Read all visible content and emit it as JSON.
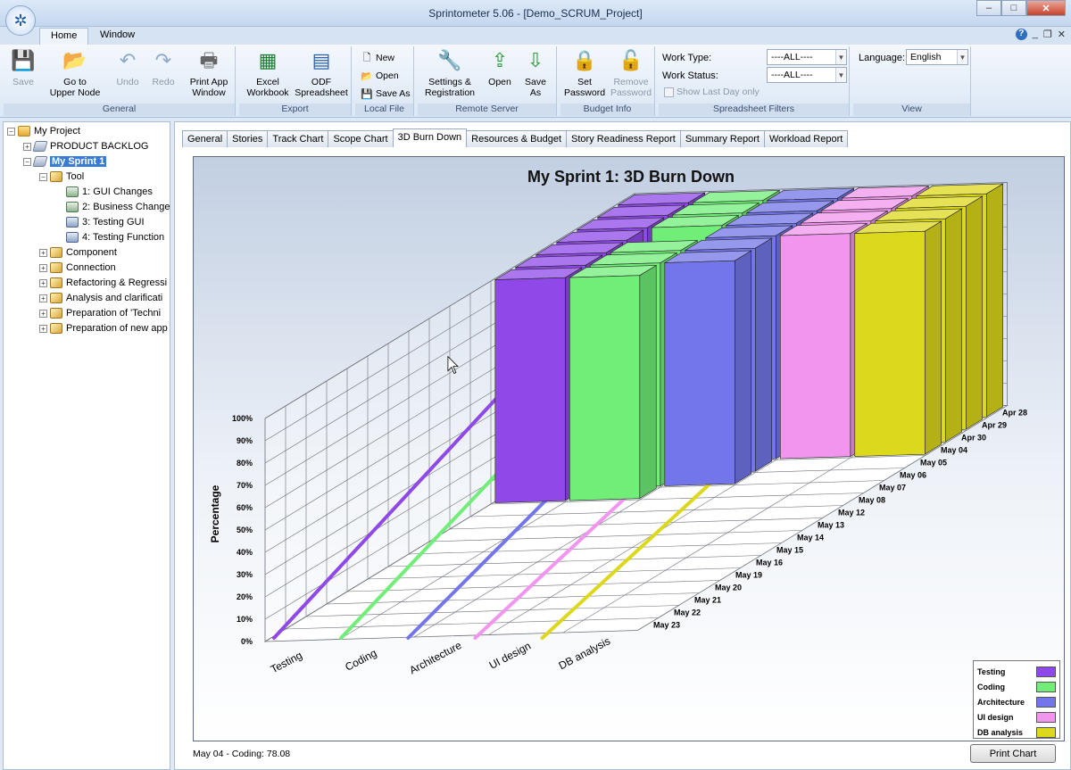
{
  "window": {
    "title": "Sprintometer 5.06 - [Demo_SCRUM_Project]",
    "min": "–",
    "max": "□",
    "close": "✕"
  },
  "ribbon_tabs": [
    "Home",
    "Window"
  ],
  "mdi": {
    "help": "?",
    "min": "_",
    "restore": "❐",
    "close": "✕"
  },
  "groups": {
    "general": "General",
    "export": "Export",
    "local_file": "Local File",
    "remote_server": "Remote Server",
    "budget_info": "Budget Info",
    "filters": "Spreadsheet Filters",
    "view": "View"
  },
  "buttons": {
    "save": "Save",
    "go_upper_1": "Go to",
    "go_upper_2": "Upper Node",
    "undo": "Undo",
    "redo": "Redo",
    "print_1": "Print App",
    "print_2": "Window",
    "excel_1": "Excel",
    "excel_2": "Workbook",
    "odf_1": "ODF",
    "odf_2": "Spreadsheet",
    "new": "New",
    "open_file": "Open",
    "save_as_file": "Save As",
    "settings_1": "Settings &",
    "settings_2": "Registration",
    "open": "Open",
    "save_as_1": "Save",
    "save_as_2": "As",
    "set_pw_1": "Set",
    "set_pw_2": "Password",
    "rem_pw_1": "Remove",
    "rem_pw_2": "Password"
  },
  "filters": {
    "work_type_label": "Work Type:",
    "work_type_value": "----ALL----",
    "work_status_label": "Work Status:",
    "work_status_value": "----ALL----",
    "last_day": "Show Last Day only"
  },
  "view": {
    "language_label": "Language:",
    "language_value": "English"
  },
  "tree": [
    {
      "label": "My Project",
      "level": 0,
      "exp": "−",
      "icon": "project-icon"
    },
    {
      "label": "PRODUCT BACKLOG",
      "level": 1,
      "exp": "+",
      "icon": "book-icon"
    },
    {
      "label": "My Sprint 1",
      "level": 1,
      "exp": "−",
      "icon": "book-icon",
      "selected": true
    },
    {
      "label": "Tool",
      "level": 2,
      "exp": "−",
      "icon": "pencil-icon"
    },
    {
      "label": "1: GUI Changes",
      "level": 3,
      "icon": "task-icon"
    },
    {
      "label": "2: Business Change",
      "level": 3,
      "icon": "task-icon"
    },
    {
      "label": "3: Testing GUI",
      "level": 3,
      "icon": "task-blue-icon"
    },
    {
      "label": "4: Testing Function",
      "level": 3,
      "icon": "task-blue-icon"
    },
    {
      "label": "Component",
      "level": 2,
      "exp": "+",
      "icon": "pencil-icon"
    },
    {
      "label": "Connection",
      "level": 2,
      "exp": "+",
      "icon": "pencil-icon"
    },
    {
      "label": "Refactoring & Regressi",
      "level": 2,
      "exp": "+",
      "icon": "pencil-icon"
    },
    {
      "label": "Analysis and clarificati",
      "level": 2,
      "exp": "+",
      "icon": "pencil-icon"
    },
    {
      "label": "Preparation of 'Techni",
      "level": 2,
      "exp": "+",
      "icon": "pencil-icon"
    },
    {
      "label": "Preparation of new app",
      "level": 2,
      "exp": "+",
      "icon": "pencil-icon"
    }
  ],
  "tabs": [
    "General",
    "Stories",
    "Track Chart",
    "Scope Chart",
    "3D Burn Down",
    "Resources & Budget",
    "Story Readiness Report",
    "Summary Report",
    "Workload Report"
  ],
  "active_tab": "3D Burn Down",
  "chart_data": {
    "type": "bar",
    "title": "My Sprint 1: 3D Burn Down",
    "ylabel": "Percentage",
    "ylim": [
      0,
      100
    ],
    "yticks": [
      "0%",
      "10%",
      "20%",
      "30%",
      "40%",
      "50%",
      "60%",
      "70%",
      "80%",
      "90%",
      "100%"
    ],
    "categories": [
      "Testing",
      "Coding",
      "Architecture",
      "UI design",
      "DB analysis"
    ],
    "dates": [
      "Apr 28",
      "Apr 29",
      "Apr 30",
      "May 04",
      "May 05",
      "May 06",
      "May 07",
      "May 08",
      "May 12",
      "May 13",
      "May 14",
      "May 15",
      "May 16",
      "May 19",
      "May 20",
      "May 21",
      "May 22",
      "May 23"
    ],
    "colors": [
      "#8f49e8",
      "#70ee78",
      "#7376e8",
      "#f195ee",
      "#dcd81c"
    ],
    "series": [
      {
        "name": "Testing",
        "values": [
          100,
          100,
          100,
          100,
          100,
          100,
          100
        ]
      },
      {
        "name": "Coding",
        "values": [
          100,
          100,
          100,
          78.08,
          100,
          100,
          100
        ]
      },
      {
        "name": "Architecture",
        "values": [
          100,
          100,
          100,
          100,
          100,
          100
        ]
      },
      {
        "name": "UI design",
        "values": [
          100,
          100,
          100,
          100
        ]
      },
      {
        "name": "DB analysis",
        "values": [
          100,
          100,
          100,
          100
        ]
      }
    ],
    "highlight": {
      "series": "Coding",
      "date": "May 04",
      "color": "#ea0f10"
    },
    "legend": {
      "position": "bottom-right"
    }
  },
  "status_text": "May 04 - Coding: 78.08",
  "print_chart": "Print Chart"
}
